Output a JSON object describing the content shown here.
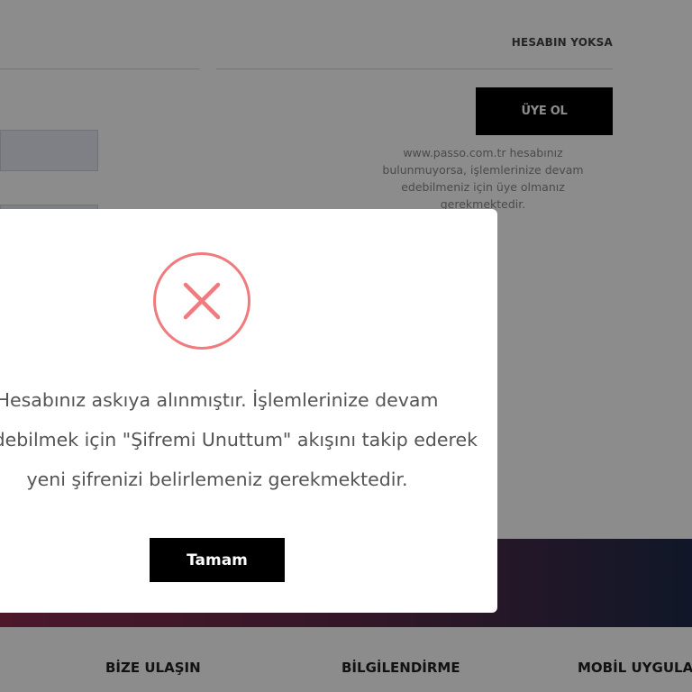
{
  "auth": {
    "no_account_heading": "HESABIN YOKSA",
    "signup_button": "ÜYE OL",
    "signup_info": "www.passo.com.tr hesabınız bulunmuyorsa, işlemlerinize devam edebilmeniz için üye olmanız gerekmektedir."
  },
  "footer": {
    "links": [
      "BİZE ULAŞIN",
      "BİLGİLENDİRME",
      "MOBİL UYGULA"
    ]
  },
  "modal": {
    "icon": "close-x-icon",
    "message_lines": [
      "Hesabınız askıya alınmıştır. İşlemlerinize devam",
      "edebilmek için \"Şifremi Unuttum\" akışını takip ederek",
      "yeni şifrenizi belirlemeniz gerekmektedir."
    ],
    "ok_button": "Tamam"
  },
  "colors": {
    "error_accent": "#f07a7d",
    "primary_button": "#000000",
    "footer_gradient_start": "#8b2d4e",
    "footer_gradient_end": "#1f2a4a"
  }
}
